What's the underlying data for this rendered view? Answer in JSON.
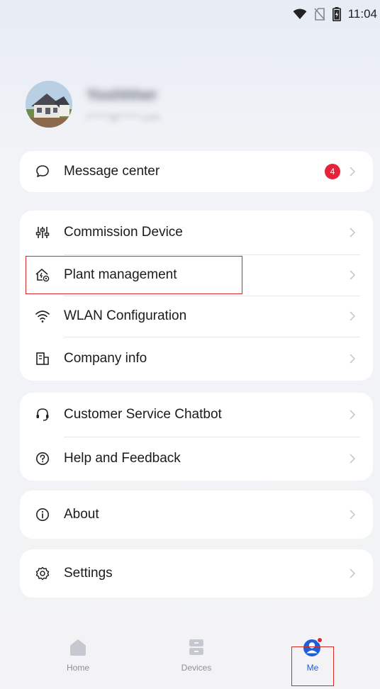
{
  "status_bar": {
    "time": "11:04",
    "icons": [
      "wifi-icon",
      "no-sim-icon",
      "battery-icon"
    ]
  },
  "profile": {
    "name": "Yoshhher",
    "subtitle": "r*****@*****.com"
  },
  "groups": [
    {
      "items": [
        {
          "id": "message-center",
          "icon": "chat-bubble-icon",
          "label": "Message center",
          "badge": "4"
        }
      ]
    },
    {
      "items": [
        {
          "id": "commission-device",
          "icon": "sliders-icon",
          "label": "Commission Device"
        },
        {
          "id": "plant-management",
          "icon": "plant-house-icon",
          "label": "Plant management",
          "highlighted": true
        },
        {
          "id": "wlan-configuration",
          "icon": "wifi-icon",
          "label": "WLAN Configuration"
        },
        {
          "id": "company-info",
          "icon": "building-icon",
          "label": "Company info"
        }
      ]
    },
    {
      "items": [
        {
          "id": "customer-service-chatbot",
          "icon": "headset-icon",
          "label": "Customer Service Chatbot"
        },
        {
          "id": "help-and-feedback",
          "icon": "question-circle-icon",
          "label": "Help and Feedback"
        }
      ]
    },
    {
      "items": [
        {
          "id": "about",
          "icon": "info-circle-icon",
          "label": "About"
        }
      ]
    },
    {
      "items": [
        {
          "id": "settings",
          "icon": "gear-icon",
          "label": "Settings"
        }
      ]
    }
  ],
  "bottom_nav": {
    "items": [
      {
        "id": "home",
        "label": "Home",
        "icon": "home-icon",
        "active": false
      },
      {
        "id": "devices",
        "label": "Devices",
        "icon": "devices-icon",
        "active": false
      },
      {
        "id": "me",
        "label": "Me",
        "icon": "person-icon",
        "active": true,
        "has_dot": true
      }
    ]
  },
  "colors": {
    "accent": "#1d5fd6",
    "badge": "#e5233a",
    "highlight_box": "#d42a2a",
    "card_bg": "#ffffff",
    "page_bg": "#f3f3f5"
  }
}
